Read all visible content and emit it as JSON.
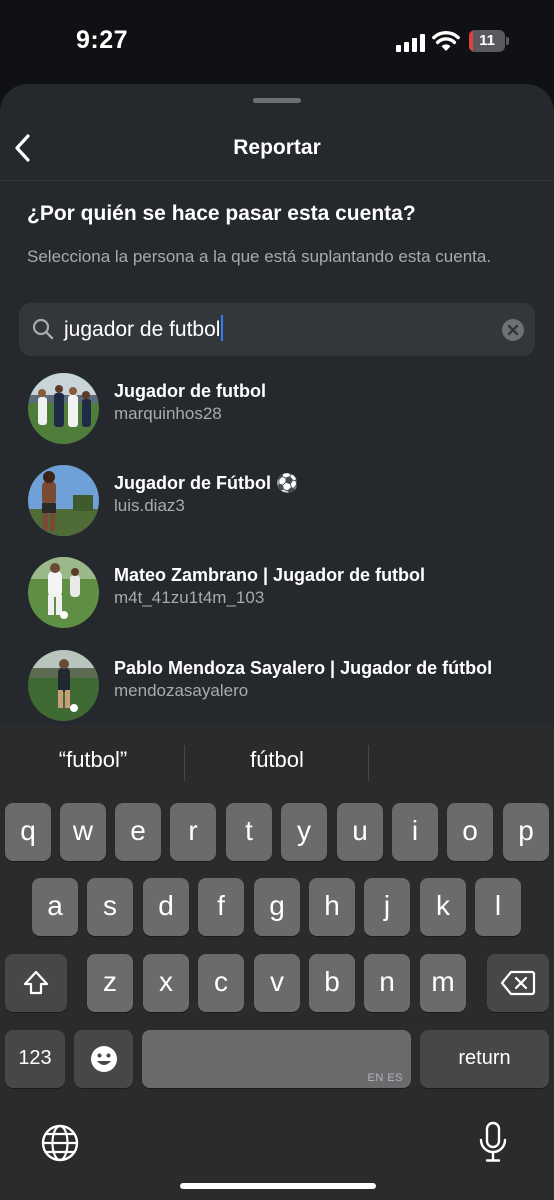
{
  "status": {
    "time": "9:27",
    "battery": "11",
    "battery_level": 0.11
  },
  "sheet": {
    "title": "Reportar",
    "question": "¿Por quién se hace pasar esta cuenta?",
    "subtitle": "Selecciona la persona a la que está suplantando esta cuenta.",
    "search": {
      "value": "jugador de futbol"
    },
    "results": [
      {
        "name": "Jugador de futbol",
        "username": "marquinhos28"
      },
      {
        "name": "Jugador de Fútbol ⚽",
        "username": "luis.diaz3"
      },
      {
        "name": "Mateo Zambrano | Jugador de futbol",
        "username": "m4t_41zu1t4m_103"
      },
      {
        "name": "Pablo Mendoza Sayalero | Jugador de fútbol",
        "username": "mendozasayalero"
      }
    ]
  },
  "keyboard": {
    "suggestions": [
      "“futbol”",
      "fútbol"
    ],
    "row1": [
      "q",
      "w",
      "e",
      "r",
      "t",
      "y",
      "u",
      "i",
      "o",
      "p"
    ],
    "row2": [
      "a",
      "s",
      "d",
      "f",
      "g",
      "h",
      "j",
      "k",
      "l"
    ],
    "row3": [
      "z",
      "x",
      "c",
      "v",
      "b",
      "n",
      "m"
    ],
    "numbers_key": "123",
    "space_lang": "EN ES",
    "return_key": "return"
  },
  "colors": {
    "sheet": "#25282c",
    "key": "#6b6b6e",
    "key_dark": "#474749",
    "caret": "#2f7ff0",
    "battery_low": "#e0413f"
  },
  "icons": [
    "signal-icon",
    "wifi-icon",
    "battery-icon",
    "back-chevron-icon",
    "search-icon",
    "clear-icon",
    "shift-icon",
    "backspace-icon",
    "emoji-icon",
    "globe-icon",
    "microphone-icon"
  ]
}
